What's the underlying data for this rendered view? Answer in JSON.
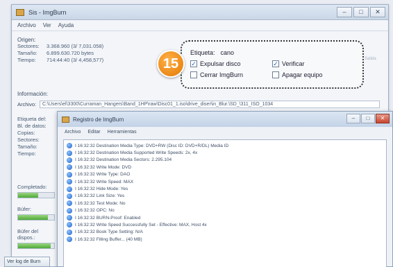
{
  "main_window": {
    "title": "Sis - ImgBurn",
    "controls": [
      "–",
      "□",
      "✕"
    ],
    "menu": [
      "Archivo",
      "Ver",
      "Ayuda"
    ]
  },
  "origin": {
    "heading": "Origen:",
    "rows": [
      {
        "k": "Sectores:",
        "v": "3.368.960 (3/ 7,031.058)"
      },
      {
        "k": "Tamaño:",
        "v": "6.899.630.720 bytes"
      },
      {
        "k": "Tiempo:",
        "v": "714:44:40 (3/ 4,458,577)"
      }
    ]
  },
  "info": {
    "heading": "Información:",
    "address_label": "Archivo:",
    "address_value": "C:\\Users\\el\\3300\\Curraman_Hangers\\Band_1HP\\raw\\Disc01_1.iso\\drive_diser\\in_Blur.\\SD_\\311_ISO_1034"
  },
  "left_col": {
    "labels": [
      "Etiqueta del:",
      "Bl. de datos:",
      "Copias:",
      "Sectores:",
      "Tamaño:",
      "Tiempo:"
    ]
  },
  "progress_groups": [
    {
      "title": "Completado:",
      "fill": 0.55
    },
    {
      "title": "Búfer:",
      "fill": 0.82
    },
    {
      "title": "Búfer del dispos.:",
      "fill": 0.9
    }
  ],
  "bottom_button": "Ver log de Burn",
  "callout": {
    "badge": "15",
    "etiqueta_label": "Etiqueta:",
    "etiqueta_value": "cano",
    "options": [
      {
        "label": "Expulsar disco",
        "checked": true
      },
      {
        "label": "Verificar",
        "checked": true
      },
      {
        "label": "Cerrar ImgBurn",
        "checked": false
      },
      {
        "label": "Apagar equipo",
        "checked": false
      }
    ],
    "faded_option": "Salida"
  },
  "dialog": {
    "title": "Registro de ImgBurn",
    "controls": [
      "–",
      "□",
      "✕"
    ],
    "menu": [
      "Archivo",
      "Editar",
      "Herramientas"
    ],
    "log": [
      "I 16:32:32 Destination Media Type: DVD+RW (Disc ID: DVD+R/DL) Media ID",
      "I 16:32:32 Destination Media Supported Write Speeds: 2x, 4x",
      "I 16:32:32 Destination Media Sectors: 2.295.104",
      "I 16:32:32 Write Mode: DVD",
      "I 16:32:32 Write Type: DAO",
      "I 16:32:32 Write Speed: MAX",
      "I 16:32:32 Hide Mode: Yes",
      "I 16:32:32 Link Size: Yes",
      "I 16:32:32 Test Mode: No",
      "I 16:32:32 OPC: No",
      "I 16:32:32 BURN-Proof: Enabled",
      "I 16:32:32 Write Speed Successfully Set - Effective: MAX, Host 4x",
      "I 16:32:32 Book Type Setting: N/A",
      "I 16:32:32 Filling Buffer... (40 MB)"
    ]
  }
}
